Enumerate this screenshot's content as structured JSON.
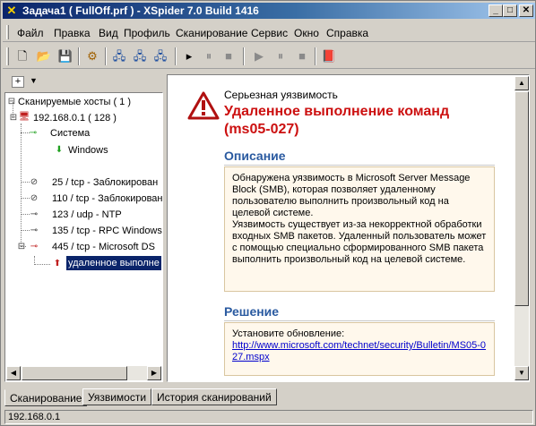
{
  "window": {
    "title": "Задача1 ( FullOff.prf ) - XSpider 7.0 Build 1416",
    "icon": "xspider-x-icon"
  },
  "menu": [
    "Файл",
    "Правка",
    "Вид",
    "Профиль",
    "Сканирование",
    "Сервис",
    "Окно",
    "Справка"
  ],
  "toolbar": {
    "icons": [
      "new-icon",
      "open-icon",
      "save-icon",
      "settings-icon",
      "add-host-icon",
      "add-range-icon",
      "remove-host-icon",
      "step-icon",
      "pause-step-icon",
      "stop-step-icon",
      "play-icon",
      "pause-icon",
      "stop-icon",
      "book-icon"
    ]
  },
  "tree": {
    "root": "Сканируемые хосты ( 1 )",
    "host": "192.168.0.1 ( 128 )",
    "system": "Система",
    "os": "Windows",
    "ports": [
      "25 / tcp - Заблокирован",
      "110 / tcp - Заблокирован",
      "123 / udp - NTP",
      "135 / tcp - RPC  Windows",
      "445 / tcp - Microsoft DS"
    ],
    "selected": "удаленное выполне"
  },
  "details": {
    "severity": "Серьезная уязвимость",
    "title_line1": "Удаленное выполнение команд",
    "title_line2": "(ms05-027)",
    "description_heading": "Описание",
    "description_p1": "Обнаружена уязвимость в Microsoft Server Message Block (SMB), которая позволяет удаленному пользователю выполнить произвольный код на целевой системе.",
    "description_p2": "Уязвимость существует из-за некорректной обработки входных SMB пакетов. Удаленный пользователь может с помощью специально сформированного SMB пакета выполнить произвольный код на целевой системе.",
    "solution_heading": "Решение",
    "solution_text": "Установите обновление:",
    "solution_link": "http://www.microsoft.com/technet/security/Bulletin/MS05-027.mspx"
  },
  "tabs": [
    "Сканирование",
    "Уязвимости",
    "История сканирований"
  ],
  "status": "192.168.0.1",
  "colors": {
    "title_gradient_start": "#0a246a",
    "title_gradient_end": "#a6caf0",
    "vuln_title": "#cc1010",
    "section_heading": "#2a5aa0",
    "box_bg": "#fff8ec"
  }
}
